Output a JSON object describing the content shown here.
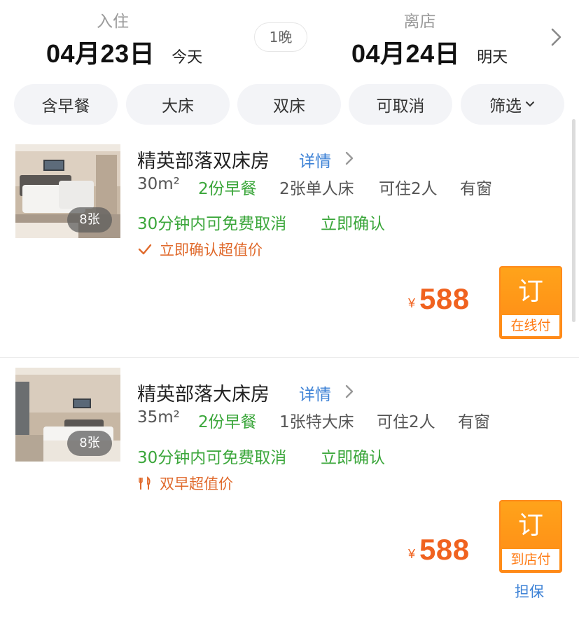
{
  "header": {
    "checkin": {
      "label": "入住",
      "date": "04月23日",
      "relative": "今天"
    },
    "nights": "1晚",
    "checkout": {
      "label": "离店",
      "date": "04月24日",
      "relative": "明天"
    }
  },
  "filters": [
    "含早餐",
    "大床",
    "双床",
    "可取消",
    "筛选"
  ],
  "rooms": [
    {
      "name": "精英部落双床房",
      "detail_label": "详情",
      "photo_count": "8张",
      "specs": {
        "area": "30m²",
        "breakfast": "2份早餐",
        "bed": "2张单人床",
        "occupancy": "可住2人",
        "window": "有窗"
      },
      "policy": {
        "cancel": "30分钟内可免费取消",
        "confirm": "立即确认"
      },
      "perk": {
        "icon": "check-icon",
        "text": "立即确认超值价"
      },
      "price": {
        "currency": "¥",
        "amount": "588"
      },
      "book": {
        "label": "订",
        "pay_type": "在线付"
      }
    },
    {
      "name": "精英部落大床房",
      "detail_label": "详情",
      "photo_count": "8张",
      "specs": {
        "area": "35m²",
        "breakfast": "2份早餐",
        "bed": "1张特大床",
        "occupancy": "可住2人",
        "window": "有窗"
      },
      "policy": {
        "cancel": "30分钟内可免费取消",
        "confirm": "立即确认"
      },
      "perk": {
        "icon": "utensils-icon",
        "text": "双早超值价"
      },
      "price": {
        "currency": "¥",
        "amount": "588"
      },
      "book": {
        "label": "订",
        "pay_type": "到店付"
      },
      "guarantee": "担保"
    }
  ],
  "colors": {
    "accent_orange": "#ff8a16",
    "price": "#f0621f",
    "green": "#3aa63a",
    "link": "#3d82d6"
  }
}
